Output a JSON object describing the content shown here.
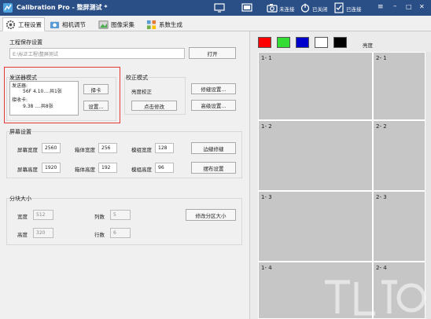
{
  "app": {
    "title": "Calibration Pro - 整屏测试 *",
    "toolbar": [
      {
        "icon": "monitor-icon",
        "label": ""
      },
      {
        "icon": "display-icon",
        "label": ""
      },
      {
        "icon": "camera-icon",
        "label": "未连接"
      },
      {
        "icon": "power-icon",
        "label": "已关闭"
      },
      {
        "icon": "link-icon",
        "label": "已连接"
      }
    ]
  },
  "tabs": [
    {
      "label": "工程设置",
      "icon": "gear-icon",
      "active": true
    },
    {
      "label": "相机调节",
      "icon": "camera-adjust-icon",
      "active": false
    },
    {
      "label": "图像采集",
      "icon": "image-capture-icon",
      "active": false
    },
    {
      "label": "系数生成",
      "icon": "coefficient-icon",
      "active": false
    }
  ],
  "project_save": {
    "title": "工程保存设置",
    "path": "E:\\标正工程\\整屏测试",
    "open_button": "打开"
  },
  "sender_mode": {
    "title": "发送器模式",
    "list_lines": [
      "发送器:",
      "56F 4.10....共1张",
      "接收卡:",
      "9.38 ....共8张"
    ],
    "select_card_button": "择卡",
    "settings_button": "设置..."
  },
  "calibration_mode": {
    "title": "校正模式",
    "mode_value": "亮度校正",
    "click_modify_button": "点击修改",
    "repair_settings_button": "修缝设置...",
    "advanced_settings_button": "高级设置..."
  },
  "screen_settings": {
    "title": "屏幕设置",
    "screen_width_label": "屏幕宽度",
    "screen_width": "2560",
    "box_width_label": "箱体宽度",
    "box_width": "256",
    "module_width_label": "模组宽度",
    "module_width": "128",
    "edge_seam_button": "边缝修缝",
    "screen_height_label": "屏幕高度",
    "screen_height": "1920",
    "box_height_label": "箱体高度",
    "box_height": "192",
    "module_height_label": "模组高度",
    "module_height": "96",
    "layout_button": "摆布设置"
  },
  "block_size": {
    "title": "分块大小",
    "width_label": "宽度",
    "width": "512",
    "cols_label": "列数",
    "cols": "5",
    "height_label": "高度",
    "height": "320",
    "rows_label": "行数",
    "rows": "6",
    "modify_button": "修改分区大小"
  },
  "preview": {
    "colors": [
      "#ff0000",
      "#33dd33",
      "#0000cc",
      "#ffffff",
      "#000000"
    ],
    "brightness_label": "亮度",
    "cells": [
      "1- 1",
      "2- 1",
      "1- 2",
      "2- 2",
      "1- 3",
      "2- 3",
      "1- 4",
      "2- 4"
    ]
  }
}
